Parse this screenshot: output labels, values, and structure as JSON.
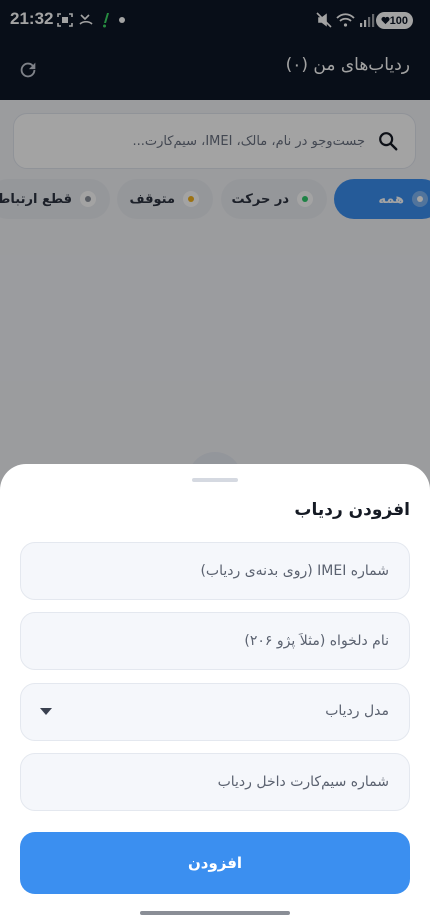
{
  "status_bar": {
    "time": "21:32",
    "battery": "100"
  },
  "app_bar": {
    "title": "ردیاب‌های من (۰)"
  },
  "search": {
    "placeholder": "جست‌وجو در نام، مالک، IMEI، سیم‌کارت..."
  },
  "filters": [
    {
      "label": "همه",
      "color": "#3b8ff0",
      "active": true
    },
    {
      "label": "در حرکت",
      "color": "#2fcb6c",
      "active": false
    },
    {
      "label": "متوقف",
      "color": "#f5b21d",
      "active": false
    },
    {
      "label": "قطع ارتباط",
      "color": "#8a909b",
      "active": false
    }
  ],
  "sheet": {
    "title": "افزودن ردیاب",
    "imei_placeholder": "شماره IMEI (روی بدنه‌ی ردیاب)",
    "name_placeholder": "نام دلخواه (مثلاً پژو ۲۰۶)",
    "model_placeholder": "مدل ردیاب",
    "sim_placeholder": "شماره سیم‌کارت داخل ردیاب",
    "submit_label": "افزودن"
  },
  "colors": {
    "app_bar_bg": "#0e1726",
    "accent": "#3b8ff0"
  },
  "icons": {
    "refresh": "refresh-icon",
    "search": "search-icon",
    "dropdown": "chevron-down-icon"
  }
}
